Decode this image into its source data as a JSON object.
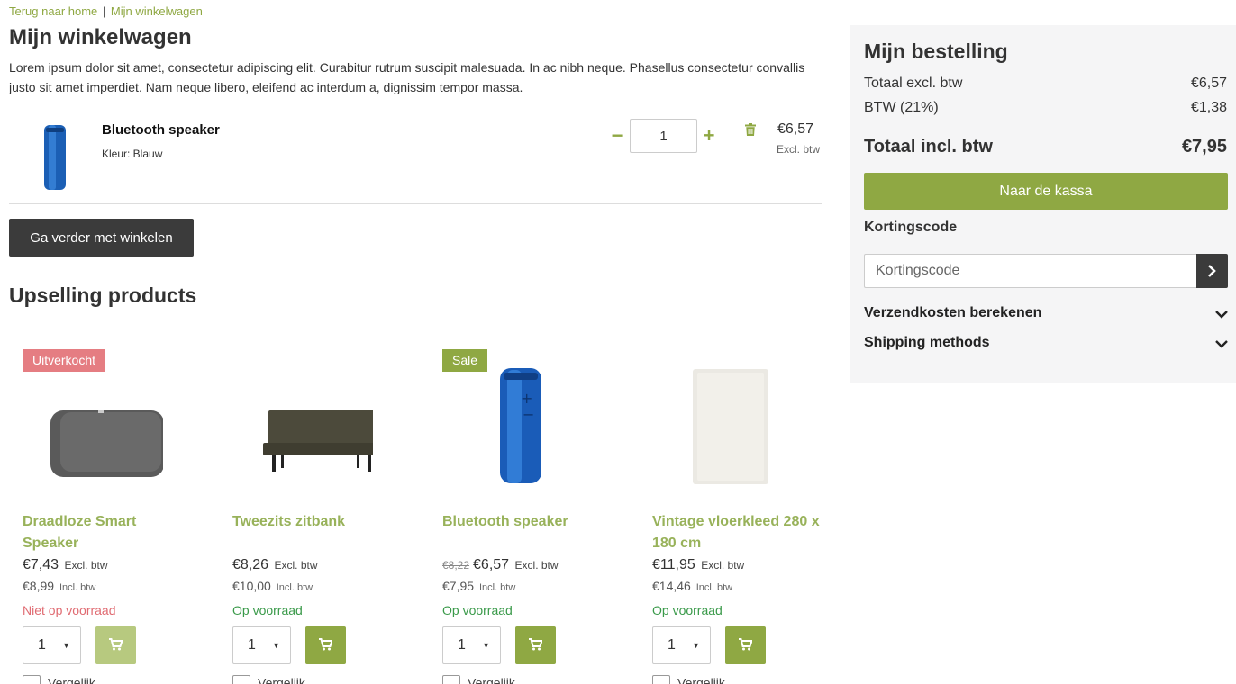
{
  "breadcrumb": {
    "home": "Terug naar home",
    "separator": "|",
    "current": "Mijn winkelwagen"
  },
  "page": {
    "title": "Mijn winkelwagen",
    "intro": "Lorem ipsum dolor sit amet, consectetur adipiscing elit. Curabitur rutrum suscipit malesuada. In ac nibh neque. Phasellus consectetur convallis justo sit amet imperdiet. Nam neque libero, eleifend ac interdum a, dignissim tempor massa."
  },
  "cart": {
    "items": [
      {
        "name": "Bluetooth speaker",
        "variant": "Kleur: Blauw",
        "quantity": "1",
        "price": "€6,57",
        "price_note": "Excl. btw",
        "minus": "−",
        "plus": "+",
        "image_icon": "blue-speaker-icon",
        "remove_icon": "trash-icon"
      }
    ],
    "continue_label": "Ga verder met winkelen"
  },
  "upsell": {
    "title": "Upselling products",
    "products": [
      {
        "name": "Draadloze Smart Speaker",
        "badge": "Uitverkocht",
        "old_price": "",
        "price": "€7,43",
        "price_tag": "Excl. btw",
        "incl_price": "€8,99",
        "incl_tag": "Incl. btw",
        "stock": "Niet op voorraad",
        "in_stock": false,
        "quantity": "1",
        "compare": "Vergelijk",
        "image_icon": "smart-speaker-icon"
      },
      {
        "name": "Tweezits zitbank",
        "badge": "",
        "old_price": "",
        "price": "€8,26",
        "price_tag": "Excl. btw",
        "incl_price": "€10,00",
        "incl_tag": "Incl. btw",
        "stock": "Op voorraad",
        "in_stock": true,
        "quantity": "1",
        "compare": "Vergelijk",
        "image_icon": "bench-sofa-icon"
      },
      {
        "name": "Bluetooth speaker",
        "badge": "Sale",
        "old_price": "€8,22",
        "price": "€6,57",
        "price_tag": "Excl. btw",
        "incl_price": "€7,95",
        "incl_tag": "Incl. btw",
        "stock": "Op voorraad",
        "in_stock": true,
        "quantity": "1",
        "compare": "Vergelijk",
        "image_icon": "blue-speaker-icon"
      },
      {
        "name": "Vintage vloerkleed 280 x 180 cm",
        "badge": "",
        "old_price": "",
        "price": "€11,95",
        "price_tag": "Excl. btw",
        "incl_price": "€14,46",
        "incl_tag": "Incl. btw",
        "stock": "Op voorraad",
        "in_stock": true,
        "quantity": "1",
        "compare": "Vergelijk",
        "image_icon": "rug-icon"
      }
    ]
  },
  "summary": {
    "title": "Mijn bestelling",
    "subtotal_label": "Totaal excl. btw",
    "subtotal_value": "€6,57",
    "vat_label": "BTW (21%)",
    "vat_value": "€1,38",
    "total_label": "Totaal incl. btw",
    "total_value": "€7,95",
    "checkout_label": "Naar de kassa",
    "discount_label": "Kortingscode",
    "discount_placeholder": "Kortingscode",
    "shipping_calc_label": "Verzendkosten berekenen",
    "shipping_methods_label": "Shipping methods"
  },
  "colors": {
    "accent": "#8fa843",
    "dark": "#3b3b3b",
    "sold_out": "#e57d82",
    "in_stock": "#3a9a4a",
    "panel": "#f5f5f6"
  }
}
